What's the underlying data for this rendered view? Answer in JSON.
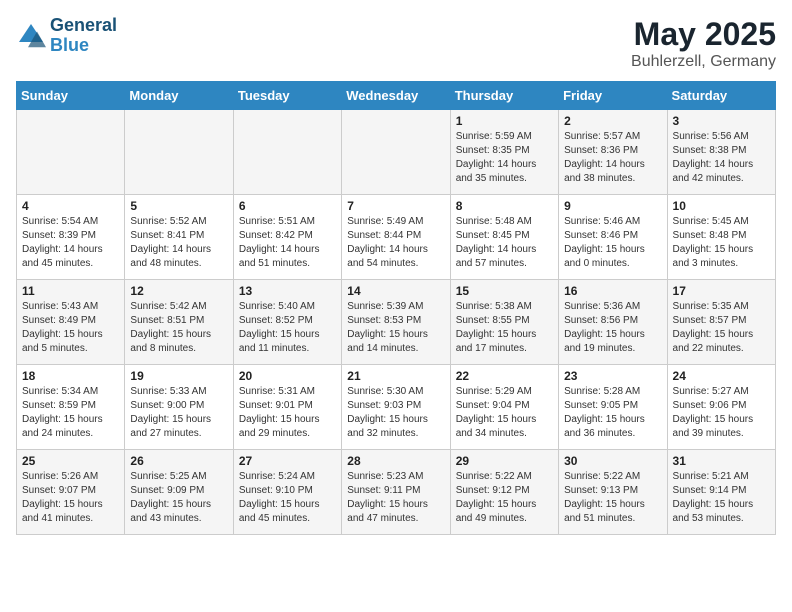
{
  "header": {
    "logo_line1": "General",
    "logo_line2": "Blue",
    "title": "May 2025",
    "subtitle": "Buhlerzell, Germany"
  },
  "weekdays": [
    "Sunday",
    "Monday",
    "Tuesday",
    "Wednesday",
    "Thursday",
    "Friday",
    "Saturday"
  ],
  "weeks": [
    [
      {
        "day": "",
        "content": ""
      },
      {
        "day": "",
        "content": ""
      },
      {
        "day": "",
        "content": ""
      },
      {
        "day": "",
        "content": ""
      },
      {
        "day": "1",
        "content": "Sunrise: 5:59 AM\nSunset: 8:35 PM\nDaylight: 14 hours\nand 35 minutes."
      },
      {
        "day": "2",
        "content": "Sunrise: 5:57 AM\nSunset: 8:36 PM\nDaylight: 14 hours\nand 38 minutes."
      },
      {
        "day": "3",
        "content": "Sunrise: 5:56 AM\nSunset: 8:38 PM\nDaylight: 14 hours\nand 42 minutes."
      }
    ],
    [
      {
        "day": "4",
        "content": "Sunrise: 5:54 AM\nSunset: 8:39 PM\nDaylight: 14 hours\nand 45 minutes."
      },
      {
        "day": "5",
        "content": "Sunrise: 5:52 AM\nSunset: 8:41 PM\nDaylight: 14 hours\nand 48 minutes."
      },
      {
        "day": "6",
        "content": "Sunrise: 5:51 AM\nSunset: 8:42 PM\nDaylight: 14 hours\nand 51 minutes."
      },
      {
        "day": "7",
        "content": "Sunrise: 5:49 AM\nSunset: 8:44 PM\nDaylight: 14 hours\nand 54 minutes."
      },
      {
        "day": "8",
        "content": "Sunrise: 5:48 AM\nSunset: 8:45 PM\nDaylight: 14 hours\nand 57 minutes."
      },
      {
        "day": "9",
        "content": "Sunrise: 5:46 AM\nSunset: 8:46 PM\nDaylight: 15 hours\nand 0 minutes."
      },
      {
        "day": "10",
        "content": "Sunrise: 5:45 AM\nSunset: 8:48 PM\nDaylight: 15 hours\nand 3 minutes."
      }
    ],
    [
      {
        "day": "11",
        "content": "Sunrise: 5:43 AM\nSunset: 8:49 PM\nDaylight: 15 hours\nand 5 minutes."
      },
      {
        "day": "12",
        "content": "Sunrise: 5:42 AM\nSunset: 8:51 PM\nDaylight: 15 hours\nand 8 minutes."
      },
      {
        "day": "13",
        "content": "Sunrise: 5:40 AM\nSunset: 8:52 PM\nDaylight: 15 hours\nand 11 minutes."
      },
      {
        "day": "14",
        "content": "Sunrise: 5:39 AM\nSunset: 8:53 PM\nDaylight: 15 hours\nand 14 minutes."
      },
      {
        "day": "15",
        "content": "Sunrise: 5:38 AM\nSunset: 8:55 PM\nDaylight: 15 hours\nand 17 minutes."
      },
      {
        "day": "16",
        "content": "Sunrise: 5:36 AM\nSunset: 8:56 PM\nDaylight: 15 hours\nand 19 minutes."
      },
      {
        "day": "17",
        "content": "Sunrise: 5:35 AM\nSunset: 8:57 PM\nDaylight: 15 hours\nand 22 minutes."
      }
    ],
    [
      {
        "day": "18",
        "content": "Sunrise: 5:34 AM\nSunset: 8:59 PM\nDaylight: 15 hours\nand 24 minutes."
      },
      {
        "day": "19",
        "content": "Sunrise: 5:33 AM\nSunset: 9:00 PM\nDaylight: 15 hours\nand 27 minutes."
      },
      {
        "day": "20",
        "content": "Sunrise: 5:31 AM\nSunset: 9:01 PM\nDaylight: 15 hours\nand 29 minutes."
      },
      {
        "day": "21",
        "content": "Sunrise: 5:30 AM\nSunset: 9:03 PM\nDaylight: 15 hours\nand 32 minutes."
      },
      {
        "day": "22",
        "content": "Sunrise: 5:29 AM\nSunset: 9:04 PM\nDaylight: 15 hours\nand 34 minutes."
      },
      {
        "day": "23",
        "content": "Sunrise: 5:28 AM\nSunset: 9:05 PM\nDaylight: 15 hours\nand 36 minutes."
      },
      {
        "day": "24",
        "content": "Sunrise: 5:27 AM\nSunset: 9:06 PM\nDaylight: 15 hours\nand 39 minutes."
      }
    ],
    [
      {
        "day": "25",
        "content": "Sunrise: 5:26 AM\nSunset: 9:07 PM\nDaylight: 15 hours\nand 41 minutes."
      },
      {
        "day": "26",
        "content": "Sunrise: 5:25 AM\nSunset: 9:09 PM\nDaylight: 15 hours\nand 43 minutes."
      },
      {
        "day": "27",
        "content": "Sunrise: 5:24 AM\nSunset: 9:10 PM\nDaylight: 15 hours\nand 45 minutes."
      },
      {
        "day": "28",
        "content": "Sunrise: 5:23 AM\nSunset: 9:11 PM\nDaylight: 15 hours\nand 47 minutes."
      },
      {
        "day": "29",
        "content": "Sunrise: 5:22 AM\nSunset: 9:12 PM\nDaylight: 15 hours\nand 49 minutes."
      },
      {
        "day": "30",
        "content": "Sunrise: 5:22 AM\nSunset: 9:13 PM\nDaylight: 15 hours\nand 51 minutes."
      },
      {
        "day": "31",
        "content": "Sunrise: 5:21 AM\nSunset: 9:14 PM\nDaylight: 15 hours\nand 53 minutes."
      }
    ]
  ]
}
